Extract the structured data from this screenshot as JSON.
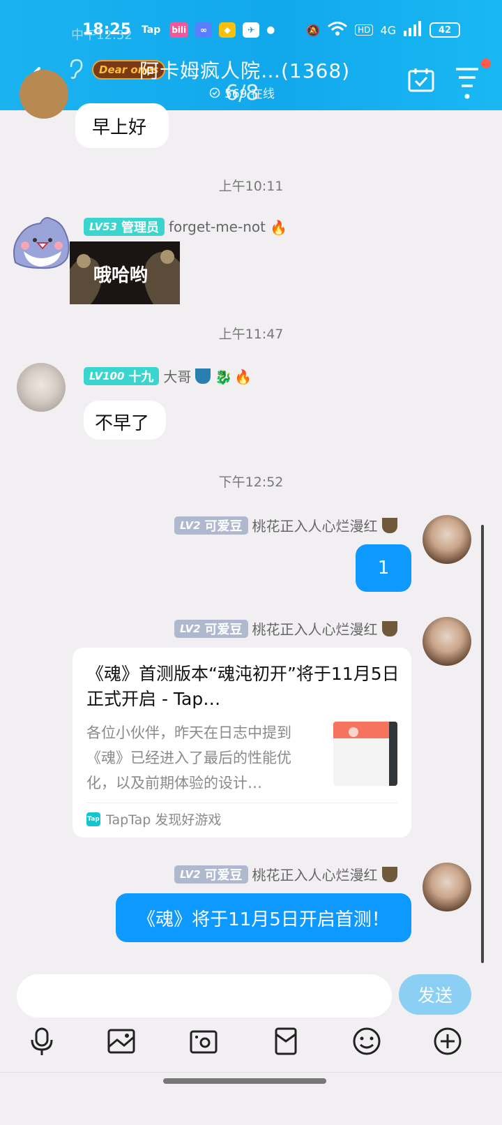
{
  "status_bar": {
    "time": "18:25",
    "carrier": "中午12:52",
    "apps": [
      "Tap",
      "bili",
      "∞",
      "◆",
      "✈"
    ],
    "network": "4G",
    "battery": "42"
  },
  "header": {
    "group_badge": "Dear ones",
    "title": "阿卡姆疯人院…(1368)",
    "online": "569 在线",
    "page_indicator": "6/8"
  },
  "messages": {
    "first_bubble": "早上好",
    "time1": "上午10:11",
    "user1": {
      "level": "LV53",
      "title": "管理员",
      "name": "forget-me-not"
    },
    "sticker_text": "哦哈哟",
    "time2": "上午11:47",
    "user2": {
      "level": "LV100",
      "title": "十九",
      "name": "大哥"
    },
    "reply2": "不早了",
    "time3": "下午12:52",
    "self": {
      "level": "LV2",
      "title": "可爱豆",
      "name": "桃花正入人心烂漫红"
    },
    "self_msg1": "1",
    "card": {
      "title": "《魂》首测版本“魂沌初开”将于11月5日正式开启 - Tap…",
      "desc": "各位小伙伴，昨天在日志中提到《魂》已经进入了最后的性能优化，以及前期体验的设计…",
      "source": "TapTap 发现好游戏",
      "source_icon": "Tap"
    },
    "self_msg3": "《魂》将于11月5日开启首测！"
  },
  "input": {
    "placeholder": "",
    "send_label": "发送"
  },
  "toolbar_icons": [
    "microphone-icon",
    "image-icon",
    "camera-icon",
    "red-packet-icon",
    "emoji-icon",
    "plus-icon"
  ],
  "colors": {
    "header": "#12a8ec",
    "bubble_self": "#0d99ff",
    "send_button": "#8ccff4",
    "level_teal": "#3cd4cf",
    "level_gray": "#aeb8cf"
  }
}
